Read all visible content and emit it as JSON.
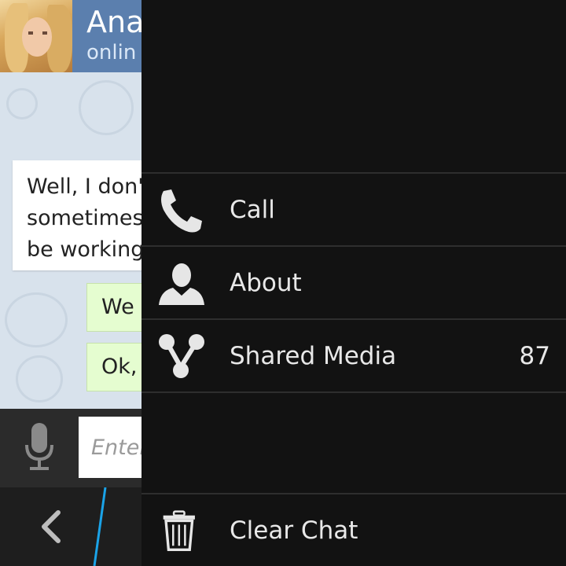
{
  "chat": {
    "contact_name": "Ana",
    "contact_status": "onlin",
    "messages": {
      "incoming": {
        "lines": [
          "Well, I don'",
          "sometimes",
          "be working"
        ]
      },
      "outgoing": [
        "We",
        "Ok,"
      ]
    },
    "input_placeholder": "Enter"
  },
  "menu": {
    "items": [
      {
        "label": "Call",
        "icon": "phone-icon"
      },
      {
        "label": "About",
        "icon": "person-icon"
      },
      {
        "label": "Shared Media",
        "icon": "share-icon",
        "count": "87"
      }
    ],
    "footer_item": {
      "label": "Clear Chat",
      "icon": "trash-icon"
    }
  },
  "colors": {
    "header": "#5b7fae",
    "chat_background": "#d8e2ec",
    "outgoing_bubble": "#e5fdd0",
    "menu_background": "#121212",
    "accent_divider": "#1aa3e8"
  }
}
